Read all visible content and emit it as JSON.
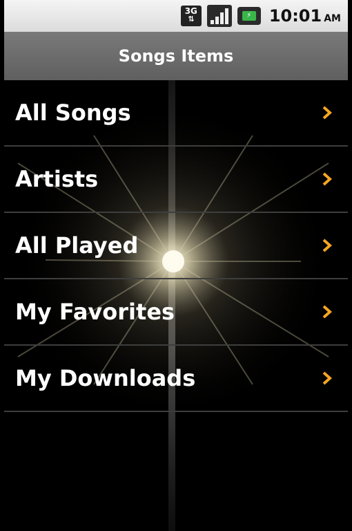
{
  "status_bar": {
    "network": "3G",
    "battery_level": 1.0,
    "time": "10:01",
    "ampm": "AM",
    "icons": [
      "3g-icon",
      "signal-icon",
      "battery-icon"
    ]
  },
  "header": {
    "title": "Songs Items"
  },
  "menu": {
    "items": [
      {
        "label": "All Songs"
      },
      {
        "label": "Artists"
      },
      {
        "label": "All Played"
      },
      {
        "label": "My Favorites"
      },
      {
        "label": "My Downloads"
      }
    ]
  },
  "colors": {
    "chevron": "#f5a623",
    "title_bar": "#6b6b6b",
    "divider": "#3e3e3e"
  }
}
